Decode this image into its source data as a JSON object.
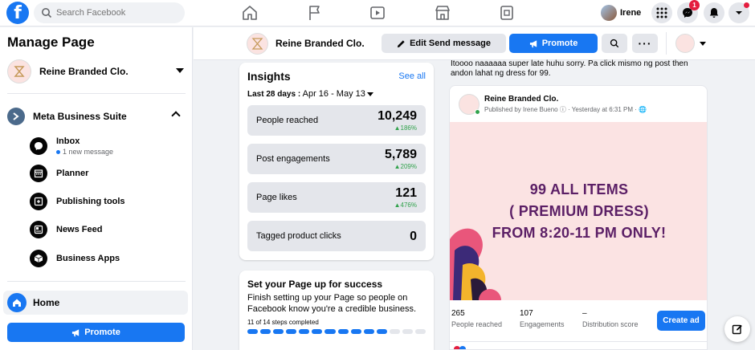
{
  "topbar": {
    "logo_letter": "f",
    "search_placeholder": "Search Facebook",
    "user_name": "Irene",
    "messenger_badge": "1"
  },
  "sidebar": {
    "title": "Manage Page",
    "page_name": "Reine Branded Clo.",
    "section_label": "Meta Business Suite",
    "items": [
      {
        "label": "Inbox",
        "sub": "1 new message",
        "icon": "inbox-icon"
      },
      {
        "label": "Planner",
        "icon": "calendar-icon"
      },
      {
        "label": "Publishing tools",
        "icon": "publishing-icon"
      },
      {
        "label": "News Feed",
        "icon": "news-feed-icon"
      },
      {
        "label": "Business Apps",
        "icon": "cube-icon"
      }
    ],
    "home_label": "Home",
    "promote_label": "Promote"
  },
  "pagebar": {
    "page_name": "Reine Branded Clo.",
    "edit_label": "Edit Send message",
    "promote_label": "Promote",
    "more_label": "···"
  },
  "insights": {
    "title": "Insights",
    "see_all": "See all",
    "range_prefix": "Last 28 days :",
    "range_value": "Apr 16 - May 13",
    "metrics": [
      {
        "label": "People reached",
        "value": "10,249",
        "change": "186%"
      },
      {
        "label": "Post engagements",
        "value": "5,789",
        "change": "209%"
      },
      {
        "label": "Page likes",
        "value": "121",
        "change": "476%"
      },
      {
        "label": "Tagged product clicks",
        "value": "0",
        "change": ""
      }
    ]
  },
  "setup": {
    "title": "Set your Page up for success",
    "desc": "Finish setting up your Page so people on Facebook know you're a credible business.",
    "steps": "11 of 14 steps completed",
    "completed": 11,
    "total": 14
  },
  "post": {
    "top_text": "Itoooo naaaaaa super late huhu sorry.  Pa click mismo ng post then andon lahat ng dress for 99.",
    "page_name": "Reine Branded Clo.",
    "meta": "Published by Irene Bueno ⓘ · Yesterday at 6:31 PM · 🌐",
    "image_lines": [
      "99 ALL ITEMS",
      "( PREMIUM DRESS)",
      "FROM 8:20-11 PM ONLY!"
    ],
    "stats": [
      {
        "value": "265",
        "label": "People reached"
      },
      {
        "value": "107",
        "label": "Engagements"
      },
      {
        "value": "–",
        "label": "Distribution score"
      }
    ],
    "create_ad_label": "Create ad"
  },
  "colors": {
    "brand_blue": "#1877f2",
    "positive_green": "#31a24c",
    "poster_bg": "#fbe3e3",
    "poster_text": "#5b1f66"
  }
}
